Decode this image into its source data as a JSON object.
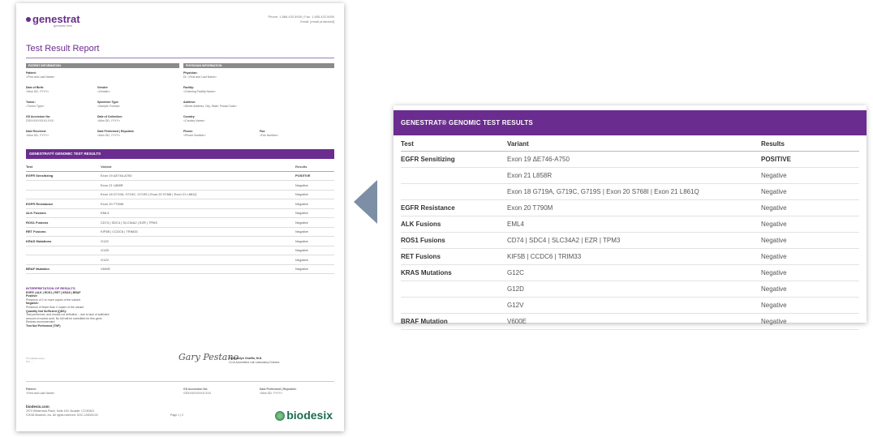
{
  "report": {
    "brand": "genestrat",
    "brand_sub": "genomic test",
    "contact_phone": "Phone: 1.866.432.5930 | Fax: 1.855.432.5930",
    "contact_email": "Email: [email protected]",
    "title": "Test Result Report",
    "patient_section": "PATIENT INFORMATION",
    "physician_section": "PHYSICIAN INFORMATION",
    "patient_fields": [
      {
        "label": "Patient:",
        "value": "<First and Last Name>"
      },
      {
        "label": "Date of Birth:",
        "value": "<Mon DD, YYYY>"
      },
      {
        "label": "Gender:",
        "value": "<Gender>"
      },
      {
        "label": "Tumor:",
        "value": "<Tumor Type>"
      },
      {
        "label": "Specimen Type:",
        "value": "<Sample Format>"
      },
      {
        "label": "GS Accession No:",
        "value": "GSXXXXXXXXX.XXX"
      },
      {
        "label": "Date of Collection:",
        "value": "<Mon DD, YYYY>"
      },
      {
        "label": "Date Received:",
        "value": "<Mon DD, YYYY>"
      },
      {
        "label": "Date Performed | Reported:",
        "value": "<Mon DD, YYYY>"
      }
    ],
    "physician_fields": [
      {
        "label": "Physician:",
        "value": "Dr. <First and Last Name>"
      },
      {
        "label": "Facility:",
        "value": "<Ordering Facility Name>"
      },
      {
        "label": "Address:",
        "value": "<Street Address, City, State, Postal Code>"
      },
      {
        "label": "Country:",
        "value": "<Country Name>"
      },
      {
        "label": "Phone:",
        "value": "<Phone Number>"
      },
      {
        "label": "Fax:",
        "value": "<Fax Number>"
      }
    ],
    "results_header": "GENESTRAT® GENOMIC TEST RESULTS",
    "interpretation": {
      "heading": "INTERPRETATION OF RESULTS",
      "genes": "EGFR | ALK | ROS1 | RET | KRAS | BRAF",
      "lines": [
        "Positive:",
        "Presence of 2 or more copies of the variant",
        "Negative:",
        "Presence of fewer than 2 copies of the variant",
        "Quantity Not Sufficient (QNS):",
        "Test performed, and results not definitive – due to lack of sufficient",
        "amount of nucleic acid. No bill will be submitted for this gene.",
        "Redraw recommended",
        "Test Not Performed (TNP)"
      ]
    },
    "fine_print": [
      "This validated assay ...",
      "This ... ..."
    ],
    "signature": "Gary Pestano",
    "signer_name": "Gwendolyn Chaffin, M.D.",
    "signer_title": "CLIA Accredited Lab Laboratory Director",
    "footer_fields": [
      {
        "label": "Patient:",
        "value": "<First and Last Name>"
      },
      {
        "label": "GS Accession No:",
        "value": "GSXXXXXXXXX.XXX"
      },
      {
        "label": "Date Performed | Reported:",
        "value": "<Mon DD, YYYY>"
      }
    ],
    "website": "biodesix.com",
    "address": "2970 Wilderness Place, Suite 100, Boulder, CO 80301",
    "copyright": "©2018 Biodesix, Inc. All rights reserved. DOC-100000-00",
    "page_number": "Page 1 | 2",
    "logo": "biodesix"
  },
  "results": {
    "header": "GENESTRAT® GENOMIC TEST RESULTS",
    "columns": [
      "Test",
      "Variant",
      "Results"
    ],
    "rows": [
      {
        "test": "EGFR Sensitizing",
        "variant": "Exon 19 ΔE746-A750",
        "result": "POSITIVE",
        "positive": true
      },
      {
        "test": "",
        "variant": "Exon 21 L858R",
        "result": "Negative"
      },
      {
        "test": "",
        "variant": "Exon 18 G719A, G719C, G719S | Exon 20 S768I | Exon 21 L861Q",
        "result": "Negative"
      },
      {
        "test": "EGFR Resistance",
        "variant": "Exon 20 T790M",
        "result": "Negative"
      },
      {
        "test": "ALK Fusions",
        "variant": "EML4",
        "result": "Negative"
      },
      {
        "test": "ROS1 Fusions",
        "variant": "CD74 | SDC4 | SLC34A2 | EZR | TPM3",
        "result": "Negative"
      },
      {
        "test": "RET Fusions",
        "variant": "KIF5B | CCDC6 | TRIM33",
        "result": "Negative"
      },
      {
        "test": "KRAS Mutations",
        "variant": "G12C",
        "result": "Negative"
      },
      {
        "test": "",
        "variant": "G12D",
        "result": "Negative"
      },
      {
        "test": "",
        "variant": "G12V",
        "result": "Negative"
      },
      {
        "test": "BRAF Mutation",
        "variant": "V600E",
        "result": "Negative"
      }
    ]
  },
  "colors": {
    "brand_purple": "#6a2c8e",
    "arrow": "#7c8fa5",
    "logo_green": "#1e6b52"
  },
  "icons": {
    "arrow": "left-arrow-icon",
    "logo": "biodesix-leaf-icon"
  }
}
